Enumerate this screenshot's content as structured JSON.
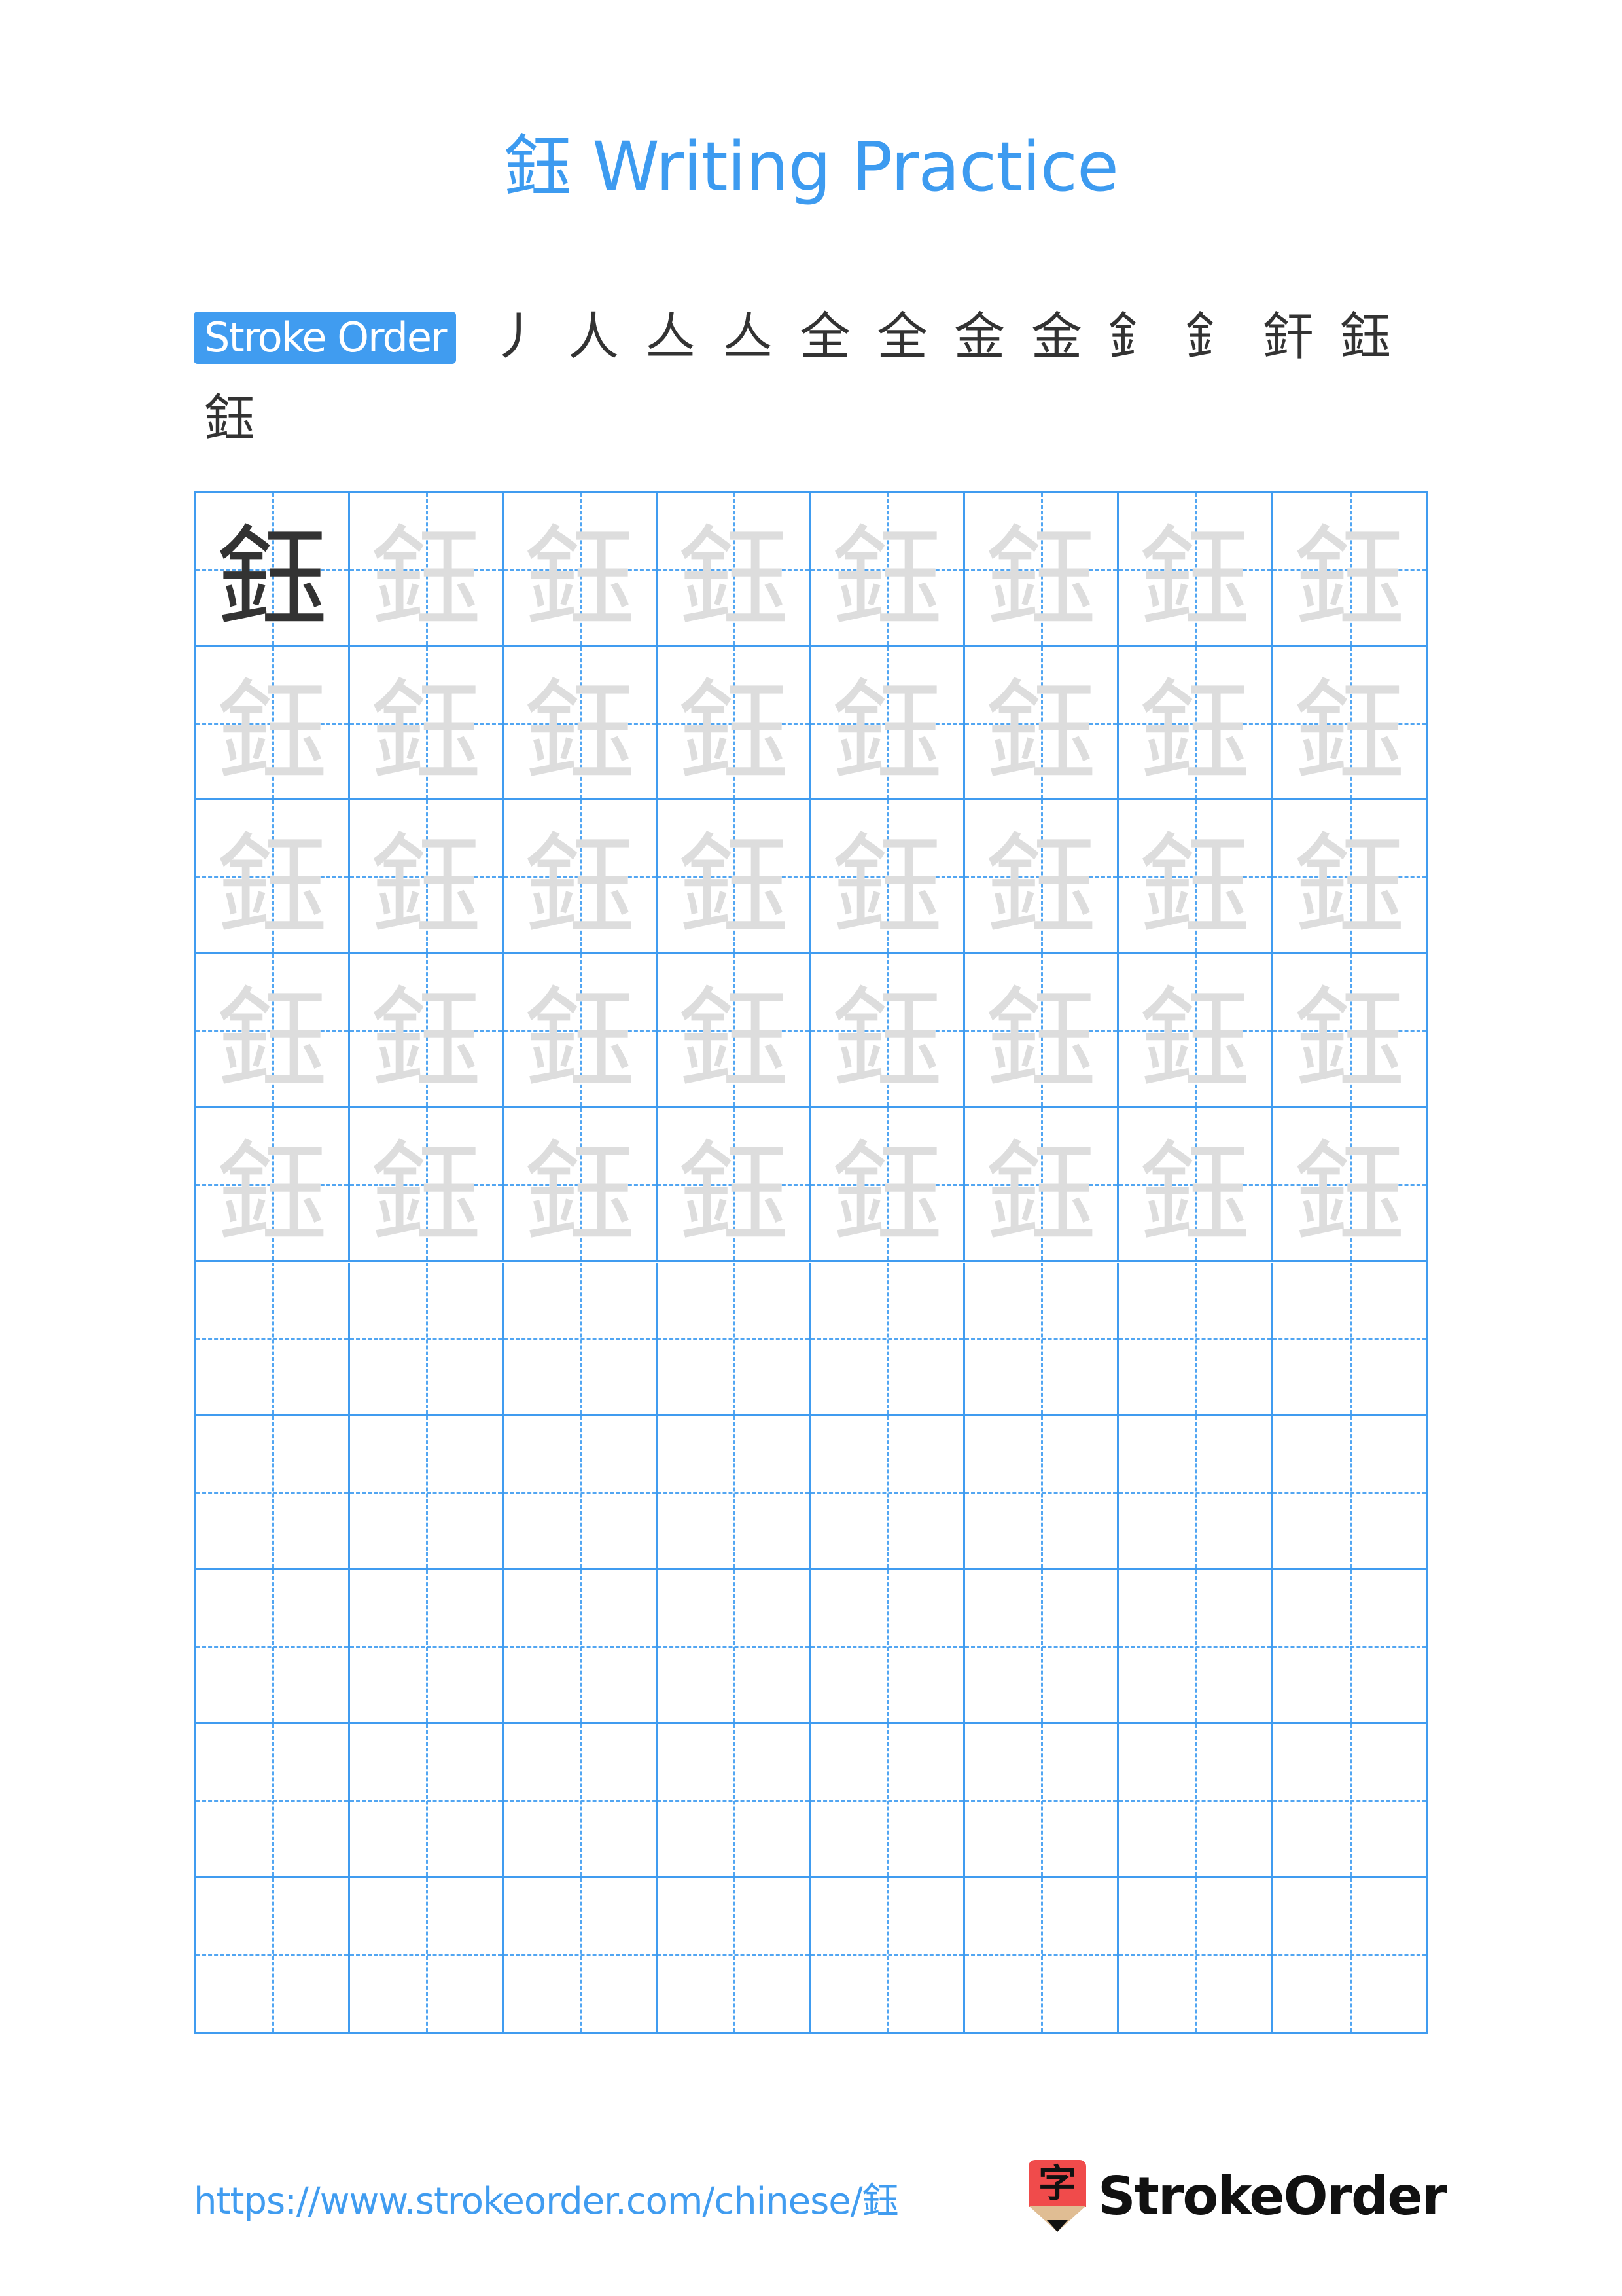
{
  "title": "鈺 Writing Practice",
  "character": "鈺",
  "stroke_order": {
    "label": "Stroke Order",
    "steps": [
      {
        "glyph": "丿",
        "step": 1
      },
      {
        "glyph": "人",
        "step": 2
      },
      {
        "glyph": "亼",
        "step": 3
      },
      {
        "glyph": "亼",
        "step": 4
      },
      {
        "glyph": "全",
        "step": 5
      },
      {
        "glyph": "全",
        "step": 6
      },
      {
        "glyph": "金",
        "step": 7
      },
      {
        "glyph": "金",
        "step": 8
      },
      {
        "glyph": "釒",
        "step": 9
      },
      {
        "glyph": "釒",
        "step": 10
      },
      {
        "glyph": "釬",
        "step": 11
      },
      {
        "glyph": "鈺",
        "step": 12
      },
      {
        "glyph": "鈺",
        "step": 13
      }
    ]
  },
  "grid": {
    "columns": 8,
    "rows": 10,
    "model_cells": 1,
    "trace_rows": 5,
    "blank_rows": 5,
    "line_color": "#409cf0",
    "model_color": "#333333",
    "trace_color": "#dddddd"
  },
  "footer": {
    "url": "https://www.strokeorder.com/chinese/鈺",
    "logo_glyph": "字",
    "logo_text": "StrokeOrder"
  },
  "colors": {
    "accent": "#409cf0",
    "highlight_stroke": "#ff0000",
    "logo_red": "#f04b4b"
  }
}
